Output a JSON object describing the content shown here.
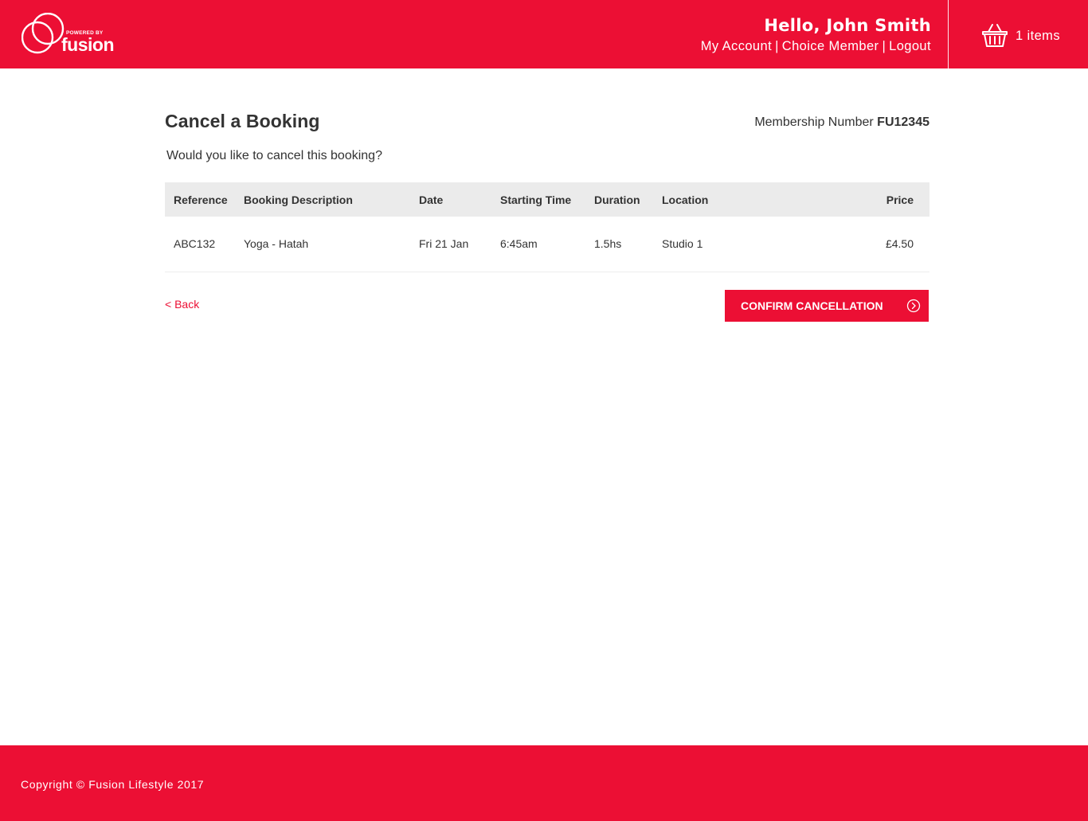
{
  "brand": {
    "color": "#EC0F34",
    "powered_by": "POWERED BY",
    "name": "fusion"
  },
  "header": {
    "greeting": "Hello, John Smith",
    "links": {
      "my_account": "My Account",
      "choice_member": "Choice Member",
      "logout": "Logout",
      "separator": "|"
    },
    "basket": {
      "icon": "basket-icon",
      "count_label": "1 items"
    }
  },
  "main": {
    "title": "Cancel a Booking",
    "membership_label": "Membership Number",
    "membership_number": "FU12345",
    "question": "Would you like to cancel this booking?",
    "table": {
      "columns": [
        "Reference",
        "Booking Description",
        "Date",
        "Starting Time",
        "Duration",
        "Location",
        "Price"
      ],
      "rows": [
        [
          "ABC132",
          "Yoga - Hatah",
          "Fri 21 Jan",
          "6:45am",
          "1.5hs",
          "Studio 1",
          "£4.50"
        ]
      ]
    },
    "back_label": "< Back",
    "confirm_label": "CONFIRM CANCELLATION",
    "confirm_icon": "chevron-right-circle-icon"
  },
  "footer": {
    "copyright": "Copyright © Fusion Lifestyle 2017"
  }
}
